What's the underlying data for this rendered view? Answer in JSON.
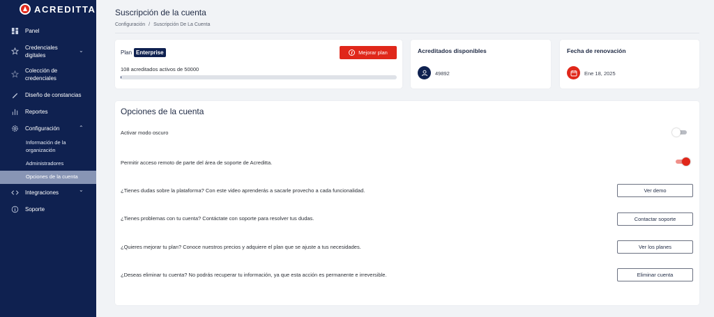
{
  "brand": {
    "name": "ACREDITTA"
  },
  "sidebar": {
    "items": [
      {
        "label": "Panel",
        "icon": "dashboard-icon"
      },
      {
        "label": "Credenciales\ndigitales",
        "icon": "star-icon"
      },
      {
        "label": "Colección de\ncredenciales",
        "icon": "star-outline-icon"
      },
      {
        "label": "Diseño de constancias",
        "icon": "pen-icon"
      },
      {
        "label": "Reportes",
        "icon": "bar-chart-icon"
      },
      {
        "label": "Configuración",
        "icon": "gear-icon"
      },
      {
        "label": "Integraciones",
        "icon": "code-icon"
      },
      {
        "label": "Soporte",
        "icon": "info-icon"
      }
    ],
    "config_sub": [
      {
        "label": "Información de la\norganización"
      },
      {
        "label": "Administradores"
      },
      {
        "label": "Opciones de la cuenta",
        "active": true
      }
    ]
  },
  "header": {
    "title": "Suscripción de la cuenta",
    "breadcrumb": [
      "Configuración",
      "/",
      "Suscripción De La Cuenta"
    ]
  },
  "plan": {
    "label": "Plan",
    "tier": "Enterprise",
    "upgrade_label": "Mejorar plan",
    "usage_text": "108 acreditados activos de 50000",
    "progress": 0.00216
  },
  "stats": {
    "acreditados": {
      "title": "Acreditados disponibles",
      "value": "49892"
    },
    "renovacion": {
      "title": "Fecha de renovación",
      "value": "Ene 18, 2025"
    }
  },
  "options": {
    "title": "Opciones de la cuenta",
    "dark_mode": {
      "label": "Activar modo oscuro",
      "on": false
    },
    "remote_access": {
      "label": "Permitir acceso remoto de parte del área de soporte de Acreditta.",
      "on": true
    },
    "actions": [
      {
        "text": "¿Tienes dudas sobre la plataforma? Con este video aprenderás a sacarle provecho a cada funcionalidad.",
        "button": "Ver demo"
      },
      {
        "text": "¿Tienes problemas con tu cuenta? Contáctate con soporte para resolver tus dudas.",
        "button": "Contactar soporte"
      },
      {
        "text": "¿Quieres mejorar tu plan? Conoce nuestros precios y adquiere el plan que se ajuste a tus necesidades.",
        "button": "Ver los planes"
      },
      {
        "text": "¿Deseas eliminar tu cuenta? No podrás recuperar tu información, ya que esta acción es permanente e irreversible.",
        "button": "Eliminar cuenta"
      }
    ]
  },
  "colors": {
    "navy": "#0f2150",
    "accent": "#e0271a",
    "active_nav": "#8895b5"
  }
}
